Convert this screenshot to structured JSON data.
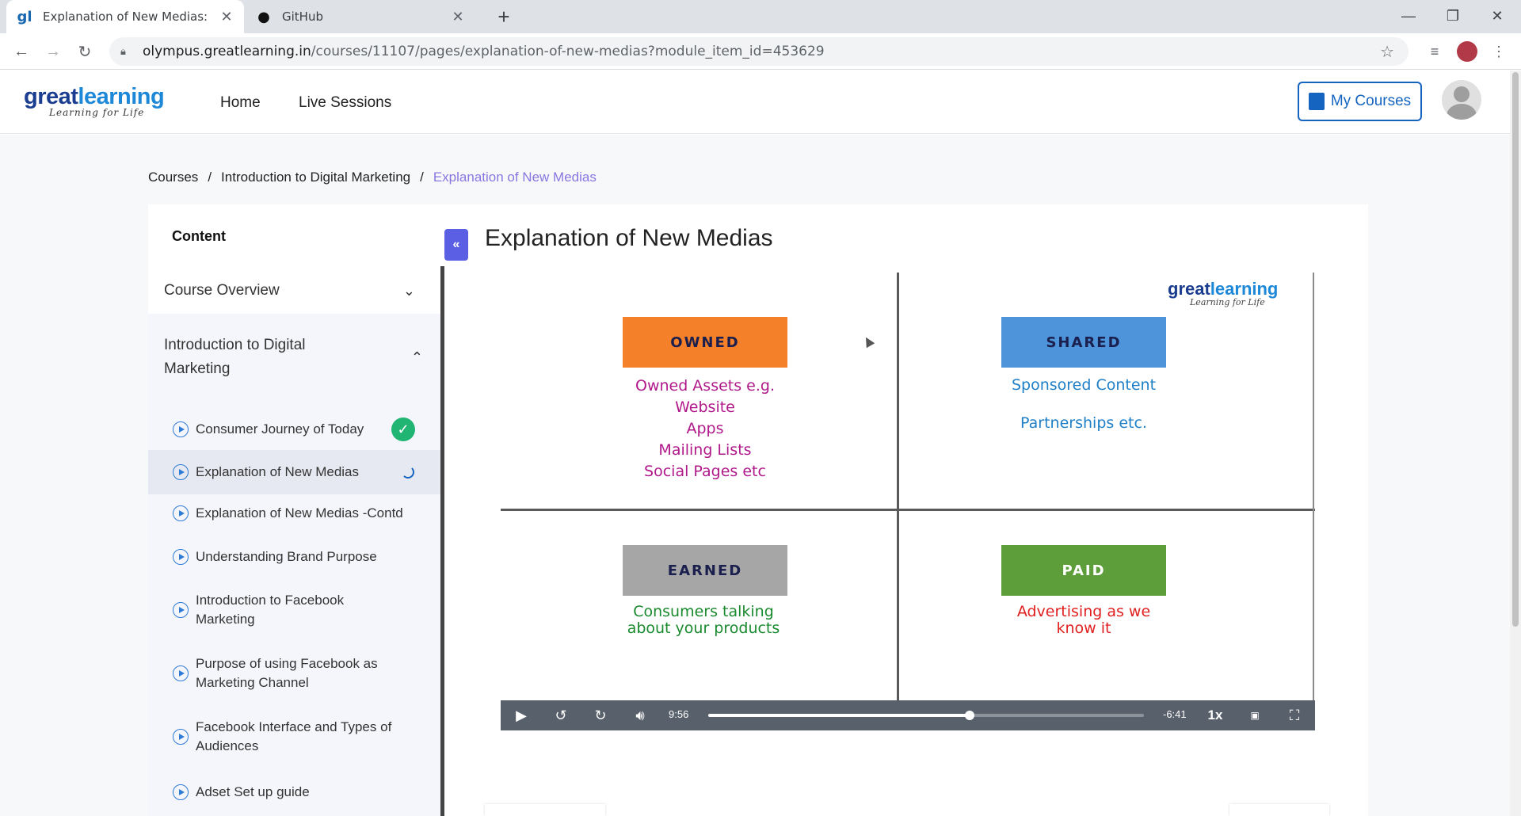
{
  "browser": {
    "tabs": [
      {
        "title": "Explanation of New Medias: ",
        "active": true
      },
      {
        "title": "GitHub",
        "active": false
      }
    ],
    "url_domain": "olympus.greatlearning.in",
    "url_path": "/courses/11107/pages/explanation-of-new-medias?module_item_id=453629"
  },
  "header": {
    "logo_great": "great",
    "logo_learning": "learning",
    "logo_tagline": "Learning for Life",
    "nav": [
      "Home",
      "Live Sessions"
    ],
    "my_courses": "My Courses"
  },
  "breadcrumb": {
    "items": [
      "Courses",
      "Introduction to Digital Marketing"
    ],
    "current": "Explanation of New Medias",
    "separator": "/"
  },
  "sidebar": {
    "title": "Content",
    "sections": [
      {
        "label": "Course Overview",
        "expanded": false
      },
      {
        "label": "Introduction to Digital Marketing",
        "expanded": true
      }
    ],
    "lessons": [
      {
        "label": "Consumer Journey of Today",
        "status": "completed"
      },
      {
        "label": "Explanation of New Medias",
        "status": "in-progress"
      },
      {
        "label": "Explanation of New Medias -Contd",
        "status": ""
      },
      {
        "label": "Understanding Brand Purpose",
        "status": ""
      },
      {
        "label": "Introduction to Facebook Marketing",
        "status": ""
      },
      {
        "label": "Purpose of using Facebook as Marketing Channel",
        "status": ""
      },
      {
        "label": "Facebook Interface and Types of Audiences",
        "status": ""
      },
      {
        "label": "Adset Set up guide",
        "status": ""
      }
    ]
  },
  "main": {
    "title": "Explanation of New Medias"
  },
  "video": {
    "slide": {
      "owned": {
        "label": "OWNED",
        "color": "#f5802a",
        "text": [
          "Owned Assets e.g.",
          "Website",
          "Apps",
          "Mailing Lists",
          "Social Pages etc"
        ],
        "text_color": "#b0198a"
      },
      "shared": {
        "label": "SHARED",
        "color": "#4d94db",
        "text": [
          "Sponsored Content",
          "",
          "Partnerships etc."
        ],
        "text_color": "#1e7fc7"
      },
      "earned": {
        "label": "EARNED",
        "color": "#a6a6a6",
        "text": [
          "Consumers talking",
          "about your products"
        ],
        "text_color": "#1a8a2e"
      },
      "paid": {
        "label": "PAID",
        "color": "#5e9e3a",
        "text": [
          "Advertising as we",
          "know it"
        ],
        "text_color": "#e02020"
      },
      "logo_great": "great",
      "logo_learning": "learning",
      "logo_tagline": "Learning for Life"
    },
    "controls": {
      "elapsed": "9:56",
      "remaining": "-6:41",
      "speed": "1x",
      "progress": 0.6
    }
  }
}
